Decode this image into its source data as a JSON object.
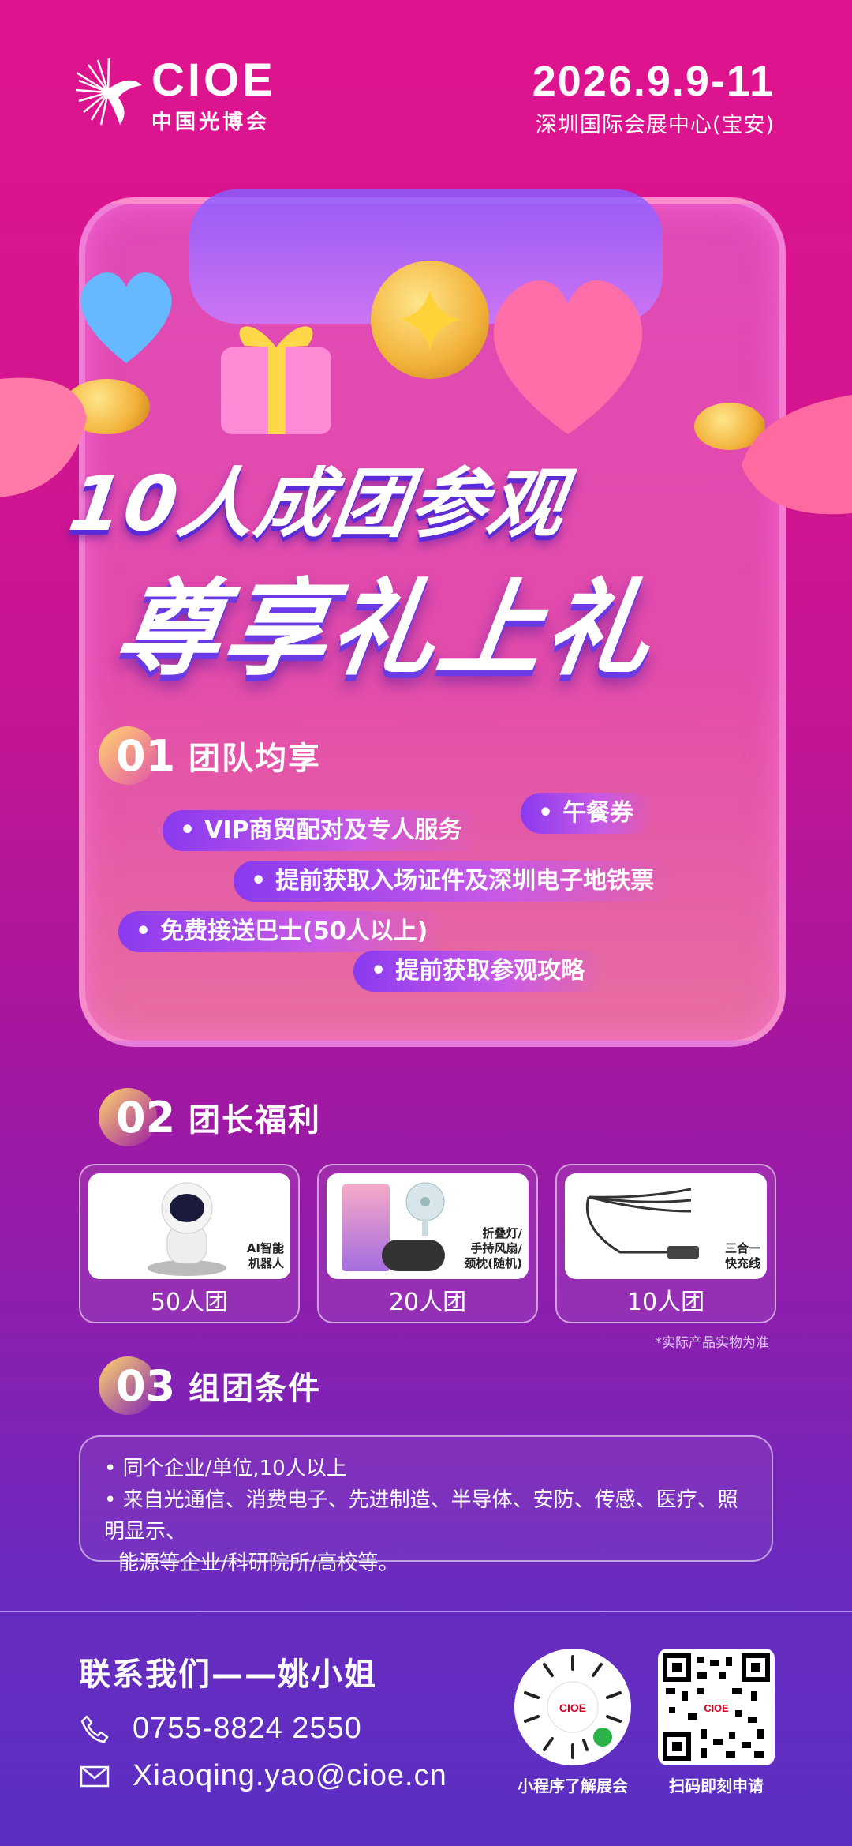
{
  "header": {
    "logo_text": "CIOE",
    "logo_sub": "中国光博会",
    "date": "2026.9.9-11",
    "venue": "深圳国际会展中心(宝安)"
  },
  "hero": {
    "title_line1": "10人成团参观",
    "title_line2": "尊享礼上礼"
  },
  "section1": {
    "num": "01",
    "title": "团队均享",
    "pills": [
      "VIP商贸配对及专人服务",
      "午餐券",
      "提前获取入场证件及深圳电子地铁票",
      "免费接送巴士(50人以上)",
      "提前获取参观攻略"
    ]
  },
  "section2": {
    "num": "02",
    "title": "团长福利",
    "cards": [
      {
        "caption_line1": "AI智能",
        "caption_line2": "机器人",
        "caption_line3": "",
        "label": "50人团"
      },
      {
        "caption_line1": "折叠灯/",
        "caption_line2": "手持风扇/",
        "caption_line3": "颈枕(随机)",
        "label": "20人团"
      },
      {
        "caption_line1": "三合一",
        "caption_line2": "快充线",
        "caption_line3": "",
        "label": "10人团"
      }
    ],
    "note": "*实际产品实物为准"
  },
  "section3": {
    "num": "03",
    "title": "组团条件",
    "line1": "同个企业/单位,10人以上",
    "line2": "来自光通信、消费电子、先进制造、半导体、安防、传感、医疗、照明显示、",
    "line3": "能源等企业/科研院所/高校等。"
  },
  "contact": {
    "title": "联系我们——姚小姐",
    "phone": "0755-8824 2550",
    "email": "Xiaoqing.yao@cioe.cn",
    "qr1_caption": "小程序了解展会",
    "qr2_caption": "扫码即刻申请",
    "phone_icon": "phone-icon",
    "email_icon": "mail-icon"
  },
  "colors": {
    "bg_top": "#e0148f",
    "bg_bottom": "#5a2fc2",
    "accent_gold": "#ffd86b",
    "pill_purple": "#8a3af0"
  }
}
